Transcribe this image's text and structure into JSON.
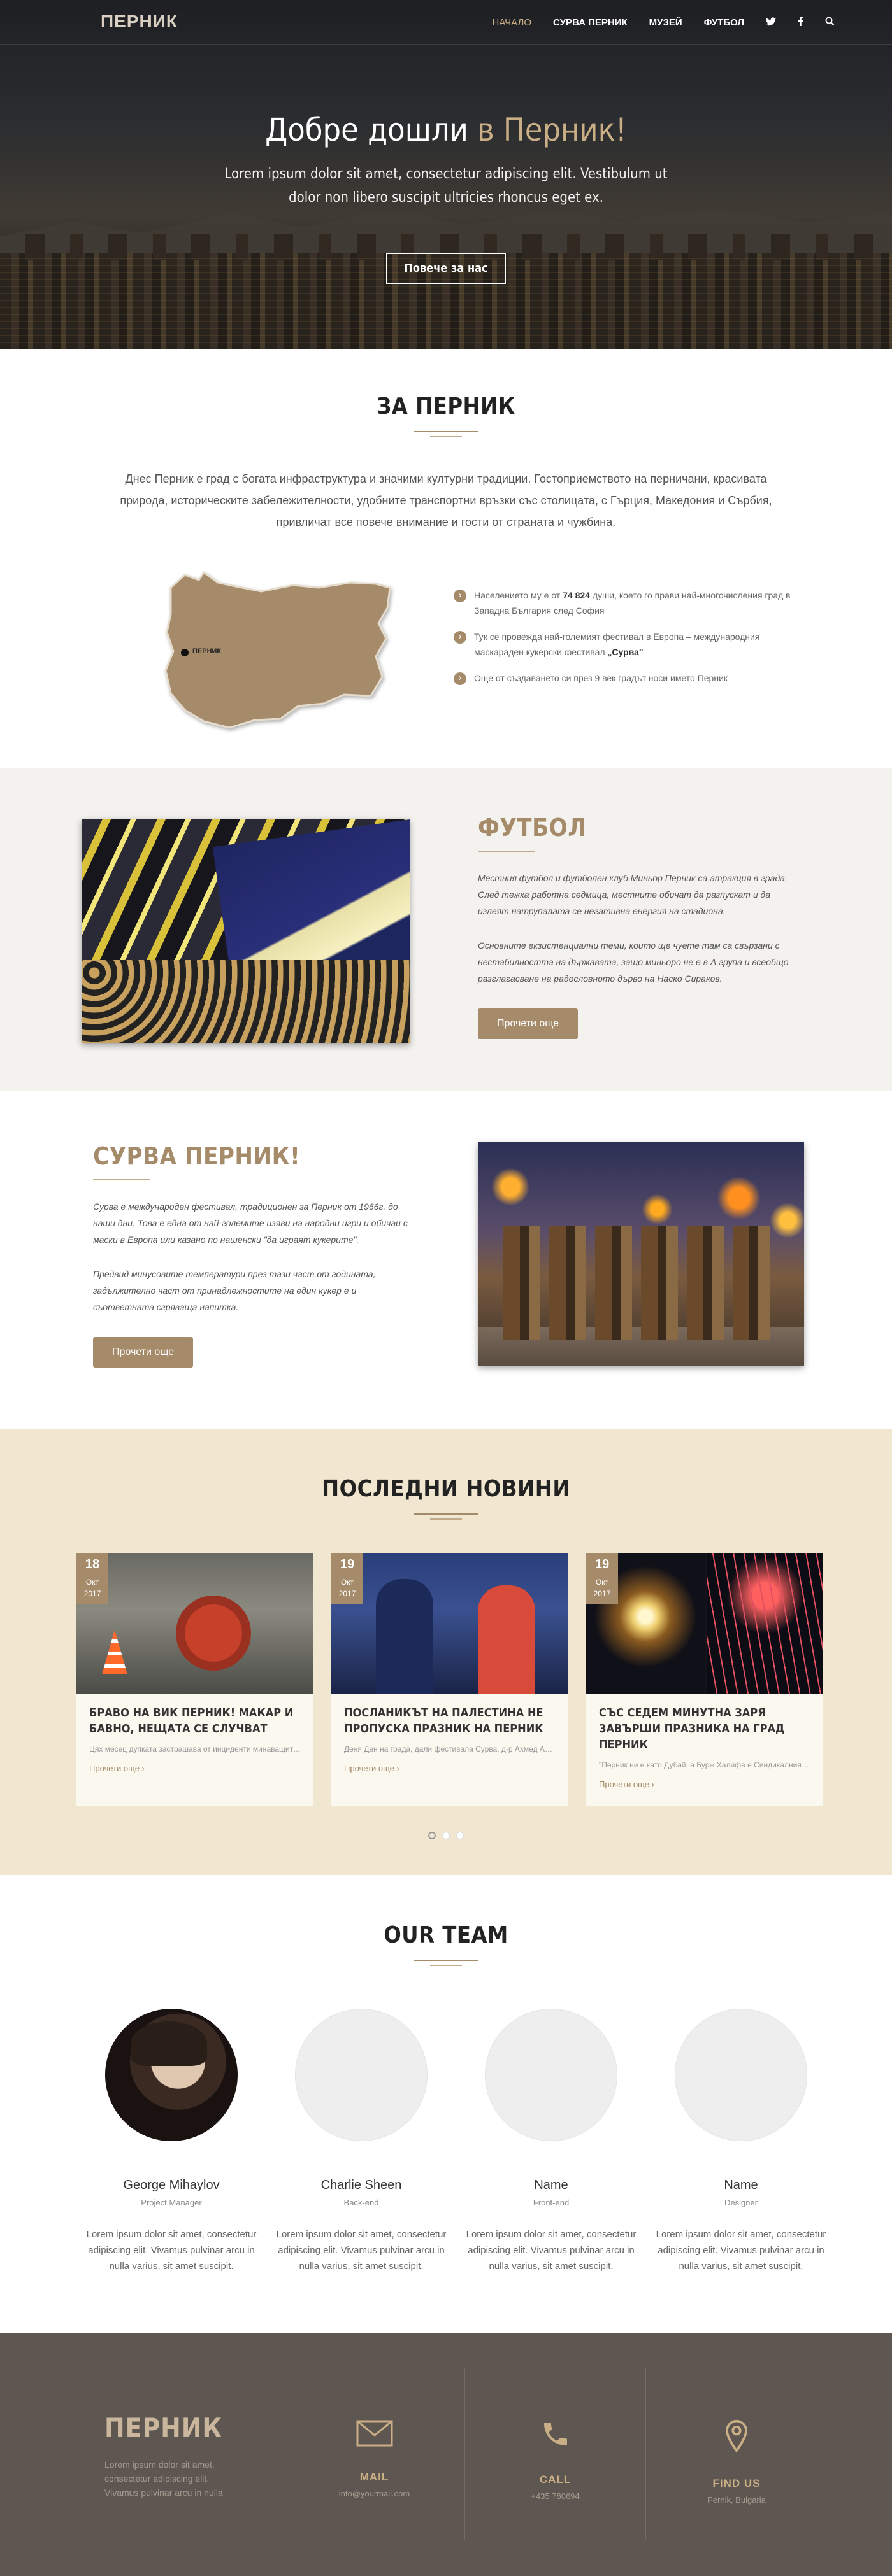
{
  "nav": {
    "logo": "ПЕРНИК",
    "items": [
      {
        "label": "НАЧАЛО",
        "active": true
      },
      {
        "label": "СУРВА ПЕРНИК"
      },
      {
        "label": "МУЗЕЙ"
      },
      {
        "label": "ФУТБОЛ"
      }
    ],
    "icons": [
      "twitter-icon",
      "facebook-icon",
      "search-icon"
    ]
  },
  "hero": {
    "title_main": "Добре дошли ",
    "title_accent": "в Перник!",
    "subtitle": "Lorem ipsum dolor sit amet, consectetur adipiscing elit. Vestibulum ut dolor non libero suscipit ultricies rhoncus eget ex.",
    "button": "Повече за нас"
  },
  "about": {
    "title": "ЗА ПЕРНИК",
    "intro": "Днес Перник е град с богата инфраструктура и значими културни традиции. Гостоприемството на перничани, красивата природа, историческите забележителности, удобните транспортни връзки със столицата, с Гърция, Македония и Сърбия, привличат все повече внимание и гости от страната и чужбина.",
    "map_label": "ПЕРНИК",
    "facts": [
      {
        "pre": "Населението му е от ",
        "bold": "74 824",
        "post": " души, което го прави най-многочисления град в Западна България след София"
      },
      {
        "pre": "Тук се провежда най-големият фестивал в Европа – международния маскараден кукерски фестивал ",
        "bold": "„Сурва\"",
        "post": ""
      },
      {
        "pre": "Още от създаването си през 9 век градът носи името Перник",
        "bold": "",
        "post": ""
      }
    ]
  },
  "football": {
    "title": "ФУТБОЛ",
    "p1": "Местния футбол и футболен клуб Миньор Перник са атракция в града. След тежка работна седмица, местните обичат да разпускат и да излеят натрупалата се негативна енергия на стадиона.",
    "p2": "Основните екзистенциални теми, които ще чуете там са свързани с нестабилността на държавата, защо миньоро не е в А група и всеобщо разглагасване на радословното дърво на Наско Сираков.",
    "button": "Прочети още"
  },
  "surva": {
    "title": "СУРВА ПЕРНИК!",
    "p1": "Сурва е международен фестивал, традиционен за Перник от 1966г. до наши дни. Това е една от най-големите изяви на народни игри и обичаи с маски в Европа или казано по нашенски \"да играят кукерите\".",
    "p2": "Предвид минусовите температури през тази част от годината, задължително част от принадлежностите на един кукер е и съответната сгряваща напитка.",
    "button": "Прочети още"
  },
  "news": {
    "title": "ПОСЛЕДНИ НОВИНИ",
    "items": [
      {
        "day": "18",
        "month": "Окт",
        "year": "2017",
        "title": "БРАВО НА ВИК ПЕРНИК! МАКАР И БАВНО, НЕЩАТА СЕ СЛУЧВАТ",
        "excerpt": "Цях месец дупката застрашава от инциденти минаващите перничани отвън, докато от инститиуцияте ...",
        "more": "Прочети още"
      },
      {
        "day": "19",
        "month": "Окт",
        "year": "2017",
        "title": "ПОСЛАНИКЪТ НА ПАЛЕСТИНА НЕ ПРОПУСКА ПРАЗНИК НА ПЕРНИК",
        "excerpt": "Деня Ден на града, дали фестивала Сурва, д-р Ахмед Ал Мадбух винаги използва повод, за да уважи града ни.",
        "more": "Прочети още"
      },
      {
        "day": "19",
        "month": "Окт",
        "year": "2017",
        "title": "СЪС СЕДЕМ МИНУТНА ЗАРЯ ЗАВЪРШИ ПРАЗНИКА НА ГРАД ПЕРНИК",
        "excerpt": "\"Перник ни е като Дубай, а Бурж Халифа е Синдикалния дом\", кицени се водещия.",
        "more": "Прочети още"
      }
    ]
  },
  "team": {
    "title": "OUR TEAM",
    "members": [
      {
        "name": "George Mihaylov",
        "role": "Project Manager",
        "desc": "Lorem ipsum dolor sit amet, consectetur adipiscing elit. Vivamus pulvinar arcu in nulla varius, sit amet suscipit."
      },
      {
        "name": "Charlie Sheen",
        "role": "Back-end",
        "desc": "Lorem ipsum dolor sit amet, consectetur adipiscing elit. Vivamus pulvinar arcu in nulla varius, sit amet suscipit."
      },
      {
        "name": "Name",
        "role": "Front-end",
        "desc": "Lorem ipsum dolor sit amet, consectetur adipiscing elit. Vivamus pulvinar arcu in nulla varius, sit amet suscipit."
      },
      {
        "name": "Name",
        "role": "Designer",
        "desc": "Lorem ipsum dolor sit amet, consectetur adipiscing elit. Vivamus pulvinar arcu in nulla varius, sit amet suscipit."
      }
    ]
  },
  "footer": {
    "logo": "ПЕРНИК",
    "text": "Lorem ipsum dolor sit amet, consectetur adipiscing elit. Vivamus pulvinar arcu in nulla",
    "contacts": [
      {
        "icon": "mail-icon",
        "label": "MAIL",
        "value": "info@yourmail.com"
      },
      {
        "icon": "phone-icon",
        "label": "CALL",
        "value": "+435 780694"
      },
      {
        "icon": "location-icon",
        "label": "FIND US",
        "value": "Pernik, Bulgaria"
      }
    ]
  },
  "colors": {
    "accent": "#a58b6a",
    "accent_light": "#c9ae86",
    "news_bg": "#f1e6cf",
    "footer_bg": "#5e5751"
  }
}
